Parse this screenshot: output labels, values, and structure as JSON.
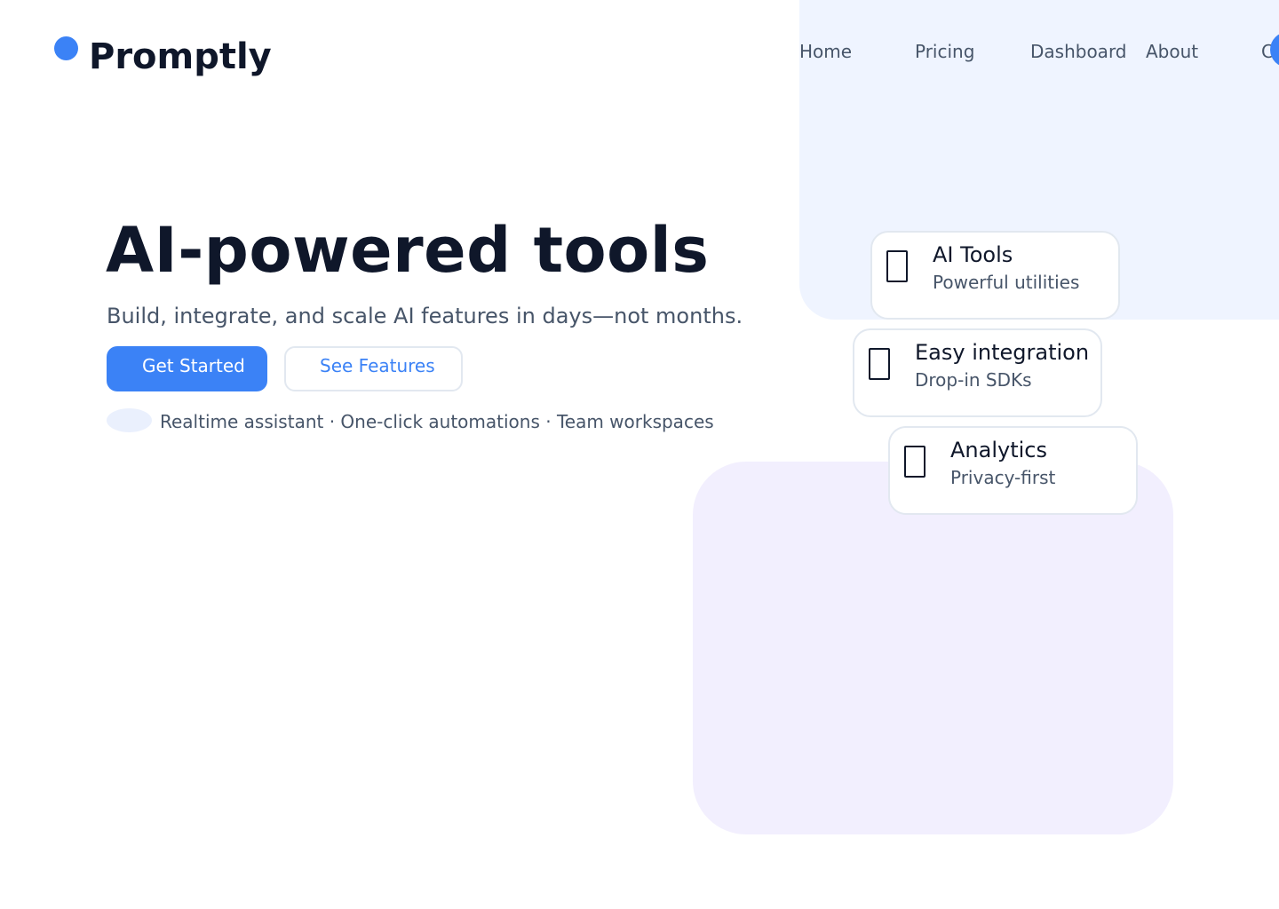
{
  "brand": {
    "name": "Promptly",
    "accent_color": "#3b82f6"
  },
  "nav": {
    "items": [
      {
        "label": "Home"
      },
      {
        "label": "Pricing"
      },
      {
        "label": "Dashboard"
      },
      {
        "label": "About"
      }
    ],
    "cut_label": "C"
  },
  "hero": {
    "title": "AI-powered tools",
    "subtitle": "Build, integrate, and scale AI features in days—not months.",
    "primary_button": "Get Started",
    "secondary_button": "See Features",
    "features_line": "Realtime assistant · One-click automations · Team workspaces"
  },
  "cards": [
    {
      "title": "AI Tools",
      "subtitle": "Powerful utilities",
      "icon": "tools-icon"
    },
    {
      "title": "Easy integration",
      "subtitle": "Drop-in SDKs",
      "icon": "integration-icon"
    },
    {
      "title": "Analytics",
      "subtitle": "Privacy-first",
      "icon": "analytics-icon"
    }
  ],
  "colors": {
    "background_top": "#eff4ff",
    "background_bottom": "#f2effe",
    "text_primary": "#0f172a",
    "text_secondary": "#475569"
  }
}
